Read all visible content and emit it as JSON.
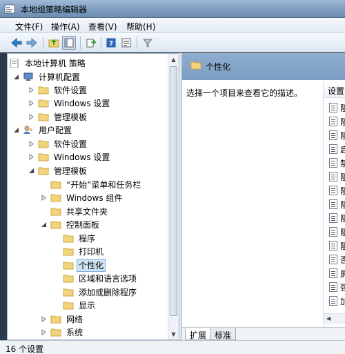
{
  "window": {
    "title": "本地组策略编辑器"
  },
  "menu": [
    {
      "label": "文件(F)"
    },
    {
      "label": "操作(A)"
    },
    {
      "label": "查看(V)"
    },
    {
      "label": "帮助(H)"
    }
  ],
  "toolbar": {
    "buttons": [
      "back-arrow-icon",
      "forward-arrow-icon",
      "up-folder-icon",
      "show-hide-tree-icon",
      "export-list-icon",
      "help-icon",
      "properties-icon",
      "filter-icon"
    ]
  },
  "tree": {
    "root": "本地计算机 策略",
    "computer_config": "计算机配置",
    "cc_software": "软件设置",
    "cc_windows": "Windows 设置",
    "cc_admin": "管理模板",
    "user_config": "用户配置",
    "uc_software": "软件设置",
    "uc_windows": "Windows 设置",
    "uc_admin": "管理模板",
    "start_menu": "“开始”菜单和任务栏",
    "windows_components": "Windows 组件",
    "shared_folders": "共享文件夹",
    "control_panel": "控制面板",
    "programs": "程序",
    "printers": "打印机",
    "personalization": "个性化",
    "regional": "区域和语言选项",
    "add_remove": "添加或删除程序",
    "display": "显示",
    "network": "网络",
    "system": "系统"
  },
  "right": {
    "header_title": "个性化",
    "description": "选择一个项目来查看它的描述。",
    "column_header": "设置",
    "items": [
      "阻",
      "阻",
      "阻",
      "启",
      "禁",
      "阻",
      "阻",
      "阻",
      "阻",
      "阻",
      "阻",
      "否",
      "屏",
      "强",
      "加"
    ],
    "tabs": {
      "extended": "扩展",
      "standard": "标准"
    }
  },
  "status": {
    "text": "16 个设置"
  },
  "colors": {
    "header": "#7c9dc2",
    "selection": "#cde4f7",
    "folder": "#f3d47a"
  }
}
